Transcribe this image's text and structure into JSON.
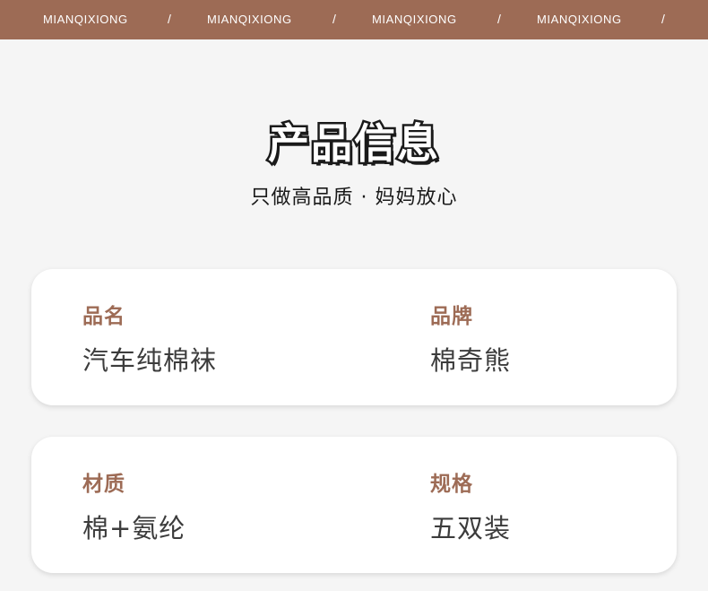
{
  "header": {
    "brand_items": [
      "MIANQIXIONG",
      "MIANQIXIONG",
      "MIANQIXIONG",
      "MIANQIXIONG"
    ],
    "separator": "/",
    "background_color": "#9d6b55"
  },
  "section": {
    "title": "产品信息",
    "subtitle": "只做高品质 · 妈妈放心"
  },
  "cards": [
    {
      "fields": [
        {
          "label": "品名",
          "value": "汽车纯棉袜"
        },
        {
          "label": "品牌",
          "value": "棉奇熊"
        }
      ]
    },
    {
      "fields": [
        {
          "label": "材质",
          "value": "棉+氨纶"
        },
        {
          "label": "规格",
          "value": "五双装"
        }
      ]
    }
  ],
  "colors": {
    "accent": "#9d6b55",
    "card_bg": "#ffffff",
    "page_bg": "#f5f5f5",
    "value_text": "#3c3c3c"
  }
}
